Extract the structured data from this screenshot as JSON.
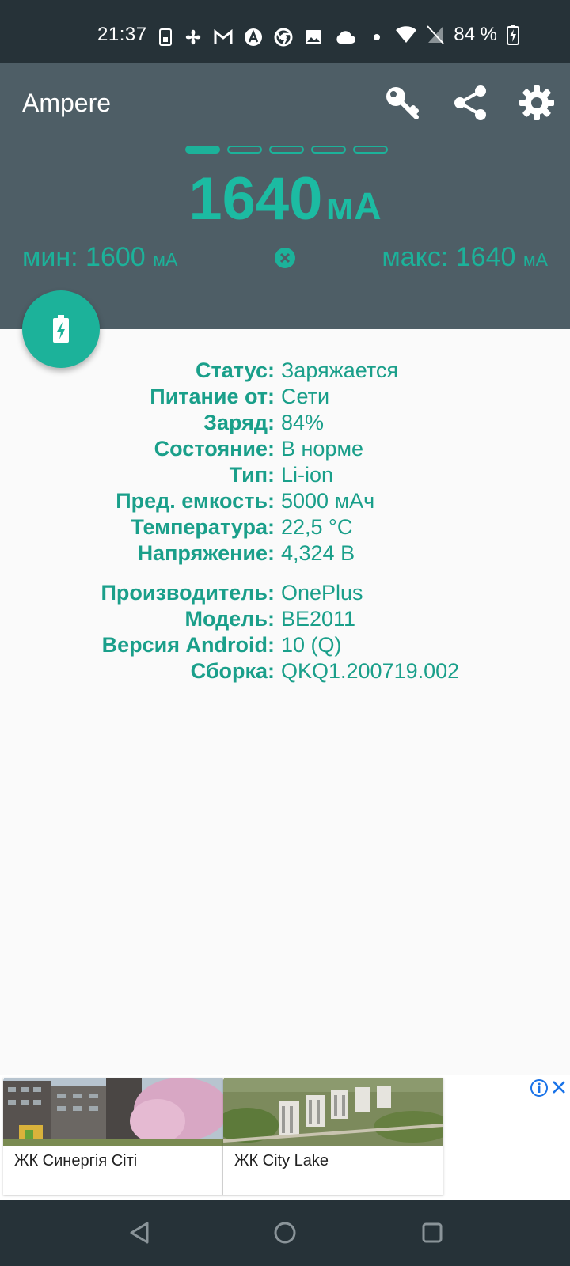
{
  "status_bar": {
    "time": "21:37",
    "battery_text": "84 %",
    "icons": [
      "sim-icon",
      "fan-icon",
      "gmail-icon",
      "accessibility-icon",
      "chrome-icon",
      "image-icon",
      "cloud-icon",
      "dot-icon",
      "wifi-icon",
      "no-sim-icon",
      "battery-charging-icon"
    ]
  },
  "app_bar": {
    "title": "Ampere",
    "actions": [
      "key-icon",
      "share-icon",
      "settings-icon"
    ]
  },
  "pager": {
    "count": 5,
    "active_index": 0
  },
  "current": {
    "value": "1640",
    "unit": "мА",
    "min_label": "мин: 1600",
    "min_unit": "мА",
    "max_label": "макс: 1640",
    "max_unit": "мА"
  },
  "colors": {
    "accent": "#1cb29a",
    "header": "#4e5e66",
    "system_bar": "#263238"
  },
  "battery_info": [
    {
      "label": "Статус:",
      "value": "Заряжается"
    },
    {
      "label": "Питание от:",
      "value": "Сети"
    },
    {
      "label": "Заряд:",
      "value": "84%"
    },
    {
      "label": "Состояние:",
      "value": "В норме"
    },
    {
      "label": "Тип:",
      "value": "Li-ion"
    },
    {
      "label": "Пред. емкость:",
      "value": "5000 мАч"
    },
    {
      "label": "Температура:",
      "value": "22,5 °C"
    },
    {
      "label": "Напряжение:",
      "value": "4,324 В"
    }
  ],
  "device_info": [
    {
      "label": "Производитель:",
      "value": "OnePlus"
    },
    {
      "label": "Модель:",
      "value": "BE2011"
    },
    {
      "label": "Версия Android:",
      "value": "10 (Q)"
    },
    {
      "label": "Сборка:",
      "value": "QKQ1.200719.002"
    }
  ],
  "ads": [
    {
      "caption": "ЖК Синергія Сіті"
    },
    {
      "caption": "ЖК City Lake"
    }
  ]
}
